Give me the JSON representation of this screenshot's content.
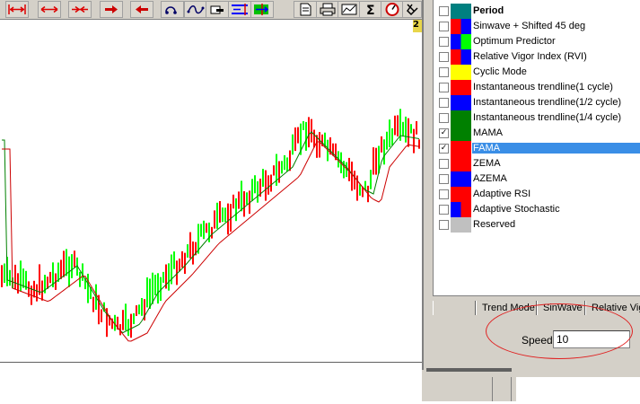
{
  "toolbar": {
    "icons": [
      "fit-width-icon",
      "expand-width-icon",
      "compress-width-icon",
      "scroll-right-icon",
      "scroll-left-icon",
      "crosshair-icon",
      "cycle-icon",
      "pointer-icon",
      "tool-blue-icon",
      "tool-green-icon",
      "page-icon",
      "print-icon",
      "chart-wizard-icon",
      "sigma-icon",
      "speed-icon",
      "toolbox-icon"
    ],
    "sigma_glyph": "Σ"
  },
  "badge": "2",
  "chart": {
    "colors": {
      "up": "#00ff00",
      "down": "#ff0000",
      "mama": "#008000",
      "fama": "#cc0000"
    }
  },
  "indicator_list": [
    {
      "label": "Period",
      "checked": false,
      "bold": true,
      "selected": false,
      "swatch": [
        "#008080",
        "#008080"
      ]
    },
    {
      "label": "Sinwave + Shifted 45 deg",
      "checked": false,
      "bold": false,
      "selected": false,
      "swatch": [
        "#ff0000",
        "#0000ff"
      ]
    },
    {
      "label": "Optimum Predictor",
      "checked": false,
      "bold": false,
      "selected": false,
      "swatch": [
        "#0000ff",
        "#00ff00"
      ]
    },
    {
      "label": "Relative Vigor Index (RVI)",
      "checked": false,
      "bold": false,
      "selected": false,
      "swatch": [
        "#ff0000",
        "#0000ff"
      ]
    },
    {
      "label": "Cyclic Mode",
      "checked": false,
      "bold": false,
      "selected": false,
      "swatch": [
        "#ffff00",
        "#ffff00"
      ]
    },
    {
      "label": "Instantaneous trendline(1 cycle)",
      "checked": false,
      "bold": false,
      "selected": false,
      "swatch": [
        "#ff0000",
        "#ff0000"
      ]
    },
    {
      "label": "Instantaneous trendline(1/2 cycle)",
      "checked": false,
      "bold": false,
      "selected": false,
      "swatch": [
        "#0000ff",
        "#0000ff"
      ]
    },
    {
      "label": "Instantaneous trendline(1/4 cycle)",
      "checked": false,
      "bold": false,
      "selected": false,
      "swatch": [
        "#008000",
        "#008000"
      ]
    },
    {
      "label": "MAMA",
      "checked": true,
      "bold": false,
      "selected": false,
      "swatch": [
        "#008000",
        "#008000"
      ]
    },
    {
      "label": "FAMA",
      "checked": true,
      "bold": false,
      "selected": true,
      "swatch": [
        "#ff0000",
        "#ff0000"
      ]
    },
    {
      "label": "ZEMA",
      "checked": false,
      "bold": false,
      "selected": false,
      "swatch": [
        "#ff0000",
        "#ff0000"
      ]
    },
    {
      "label": "AZEMA",
      "checked": false,
      "bold": false,
      "selected": false,
      "swatch": [
        "#0000ff",
        "#0000ff"
      ]
    },
    {
      "label": "Adaptive RSI",
      "checked": false,
      "bold": false,
      "selected": false,
      "swatch": [
        "#ff0000",
        "#ff0000"
      ]
    },
    {
      "label": "Adaptive Stochastic",
      "checked": false,
      "bold": false,
      "selected": false,
      "swatch": [
        "#0000ff",
        "#ff0000"
      ]
    },
    {
      "label": "Reserved",
      "checked": false,
      "bold": false,
      "selected": false,
      "swatch": [
        "#c0c0c0",
        "#c0c0c0"
      ]
    }
  ],
  "tabs": [
    "",
    "Trend Mode",
    "SinWave",
    "Relative Vig"
  ],
  "speed": {
    "label": "Speed",
    "value": "10"
  },
  "colors": {
    "callout": "#e02020",
    "selection": "#3a8ee6"
  }
}
